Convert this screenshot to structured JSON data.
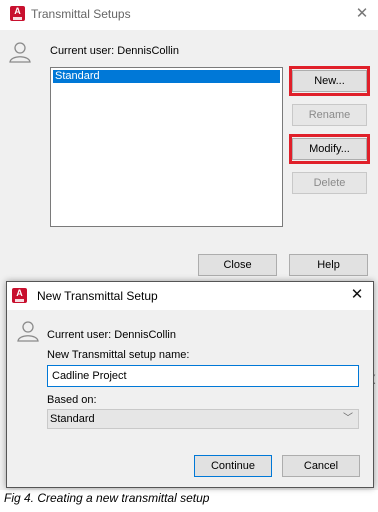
{
  "background_dialog": {
    "title": "Transmittal Setups",
    "current_user": "Current user: DennisCollin",
    "setups": [
      "Standard"
    ],
    "buttons": {
      "new": "New...",
      "rename": "Rename",
      "modify": "Modify...",
      "delete": "Delete",
      "close": "Close",
      "help": "Help"
    }
  },
  "new_setup_dialog": {
    "title": "New Transmittal Setup",
    "current_user": "Current user: DennisCollin",
    "name_label": "New Transmittal setup name:",
    "name_value": "Cadline Project",
    "based_on_label": "Based on:",
    "based_on_value": "Standard",
    "buttons": {
      "continue": "Continue",
      "cancel": "Cancel"
    }
  },
  "caption": "Fig 4. Creating a new transmittal setup",
  "icons": {
    "app": "autocad-app-icon",
    "user": "user-icon",
    "close": "close-icon",
    "dropdown": "chevron-down-icon"
  },
  "colors": {
    "selection": "#0078d7",
    "highlight": "#e0202a",
    "app_icon": "#c8102e",
    "dialog_bg": "#f0f0f0"
  }
}
